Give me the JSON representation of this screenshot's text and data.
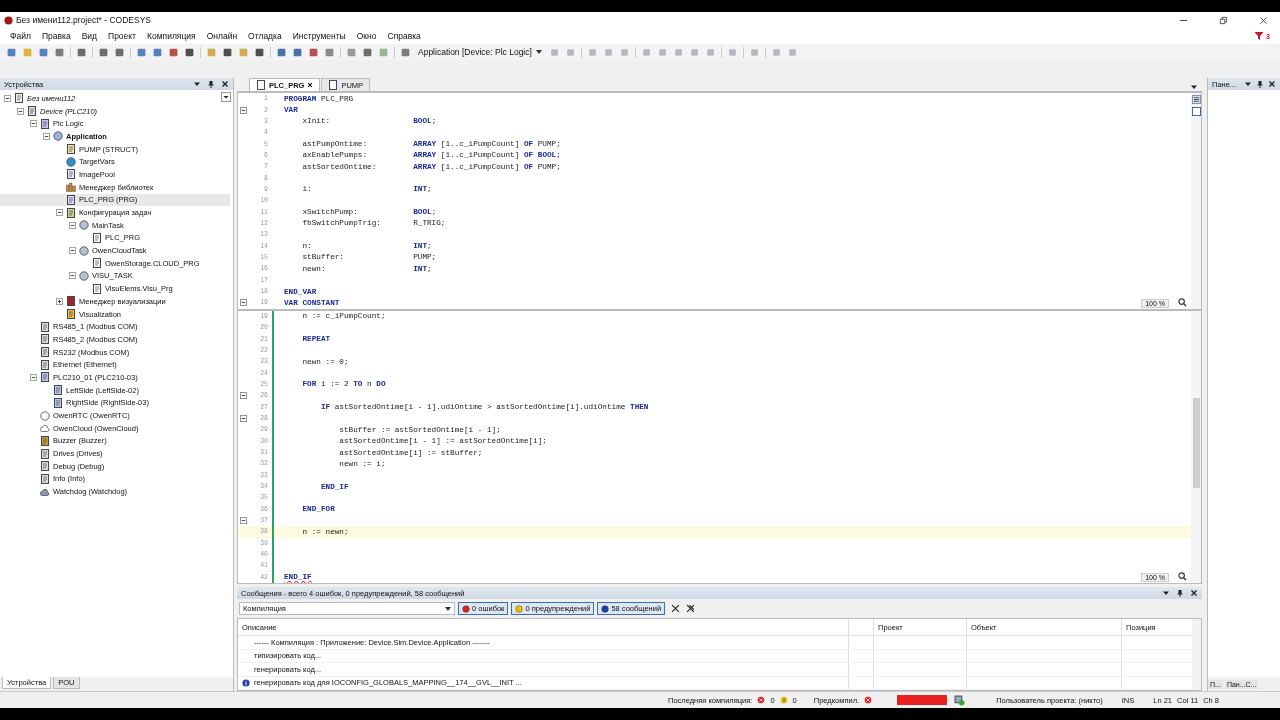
{
  "window": {
    "title": "Без имени112.project* - CODESYS"
  },
  "menu": [
    "Файл",
    "Правка",
    "Вид",
    "Проект",
    "Компиляция",
    "Онлайн",
    "Отладка",
    "Инструменты",
    "Окно",
    "Справка"
  ],
  "notification": {
    "count": "3"
  },
  "toolbar": {
    "application_selector": "Application [Device: Plc Logic]"
  },
  "devices_panel": {
    "title": "Устройства",
    "tree": [
      {
        "label": "Без имени112",
        "kind": "project",
        "expanded": true,
        "selected": false,
        "children": [
          {
            "label": "Device (PLC210)",
            "kind": "device",
            "expanded": true,
            "selected": false,
            "children": [
              {
                "label": "Plc Logic",
                "kind": "logic",
                "expanded": true,
                "selected": false,
                "children": [
                  {
                    "label": "Application",
                    "kind": "application",
                    "expanded": true,
                    "selected": false,
                    "children": [
                      {
                        "label": "PUMP (STRUCT)",
                        "kind": "struct",
                        "selected": false
                      },
                      {
                        "label": "TargetVars",
                        "kind": "globals",
                        "selected": false
                      },
                      {
                        "label": "ImagePool",
                        "kind": "images",
                        "selected": false
                      },
                      {
                        "label": "Менеджер библиотек",
                        "kind": "library",
                        "selected": false
                      },
                      {
                        "label": "PLC_PRG (PRG)",
                        "kind": "program",
                        "selected": true
                      },
                      {
                        "label": "Конфигурация задач",
                        "kind": "tasks",
                        "expanded": true,
                        "selected": false,
                        "children": [
                          {
                            "label": "MainTask",
                            "kind": "task",
                            "expanded": true,
                            "selected": false,
                            "children": [
                              {
                                "label": "PLC_PRG",
                                "kind": "call",
                                "selected": false
                              }
                            ]
                          },
                          {
                            "label": "OwenCloudTask",
                            "kind": "task",
                            "expanded": true,
                            "selected": false,
                            "children": [
                              {
                                "label": "OwenStorage.CLOUD_PRG",
                                "kind": "call",
                                "selected": false
                              }
                            ]
                          },
                          {
                            "label": "VISU_TASK",
                            "kind": "task",
                            "expanded": true,
                            "selected": false,
                            "children": [
                              {
                                "label": "VisuElems.Visu_Prg",
                                "kind": "call",
                                "selected": false
                              }
                            ]
                          }
                        ]
                      },
                      {
                        "label": "Менеджер визуализации",
                        "kind": "visu_manager",
                        "expanded": false,
                        "selected": false
                      },
                      {
                        "label": "Visualization",
                        "kind": "visualization",
                        "selected": false
                      }
                    ]
                  }
                ]
              },
              {
                "label": "RS485_1 (Modbus COM)",
                "kind": "port",
                "selected": false
              },
              {
                "label": "RS485_2 (Modbus COM)",
                "kind": "port",
                "selected": false
              },
              {
                "label": "RS232 (Modbus COM)",
                "kind": "port",
                "selected": false
              },
              {
                "label": "Ethernet (Ethernet)",
                "kind": "port",
                "selected": false
              },
              {
                "label": "PLC210_01 (PLC210-03)",
                "kind": "module",
                "expanded": true,
                "selected": false,
                "children": [
                  {
                    "label": "LeftSide (LeftSide-02)",
                    "kind": "module",
                    "selected": false
                  },
                  {
                    "label": "RightSide (RightSide-03)",
                    "kind": "module",
                    "selected": false
                  }
                ]
              },
              {
                "label": "OwenRTC (OwenRTC)",
                "kind": "clock",
                "selected": false
              },
              {
                "label": "OwenCloud (OwenCloud)",
                "kind": "cloud",
                "selected": false
              },
              {
                "label": "Buzzer (Buzzer)",
                "kind": "speaker",
                "selected": false
              },
              {
                "label": "Drives (Drives)",
                "kind": "port",
                "selected": false
              },
              {
                "label": "Debug (Debug)",
                "kind": "port",
                "selected": false
              },
              {
                "label": "Info (Info)",
                "kind": "port",
                "selected": false
              },
              {
                "label": "Watchdog (Watchdog)",
                "kind": "watchdog",
                "selected": false
              }
            ]
          }
        ]
      }
    ]
  },
  "bottom_tabs": [
    {
      "label": "Устройства",
      "selected": true
    },
    {
      "label": "POU",
      "selected": false
    }
  ],
  "editor": {
    "tabs": [
      {
        "label": "PLC_PRG",
        "selected": true,
        "closable": true
      },
      {
        "label": "PUMP",
        "selected": false,
        "closable": false
      }
    ],
    "declaration": {
      "zoom": "100 %",
      "lines": [
        {
          "n": "1",
          "text": "**PROGRAM** PLC_PRG",
          "fold": false
        },
        {
          "n": "2",
          "text": "**VAR**",
          "fold": true
        },
        {
          "n": "3",
          "text": "    xInit:                  **BOOL**;",
          "fold": false
        },
        {
          "n": "4",
          "fold": false
        },
        {
          "n": "5",
          "text": "    astPumpOntime:          **ARRAY** [1..c_iPumpCount] **OF** PUMP;",
          "fold": false
        },
        {
          "n": "6",
          "text": "    axEnablePumps:          **ARRAY** [1..c_iPumpCount] **OF** **BOOL**;",
          "fold": false
        },
        {
          "n": "7",
          "text": "    astSortedOntime:        **ARRAY** [1..c_iPumpCount] **OF** PUMP;",
          "fold": false
        },
        {
          "n": "8",
          "fold": false
        },
        {
          "n": "9",
          "text": "    i:                      **INT**;",
          "fold": false
        },
        {
          "n": "10",
          "fold": false
        },
        {
          "n": "11",
          "text": "    xSwitchPump:            **BOOL**;",
          "fold": false
        },
        {
          "n": "12",
          "text": "    fbSwitchPumpTrig:       R_TRIG;",
          "fold": false
        },
        {
          "n": "13",
          "fold": false
        },
        {
          "n": "14",
          "text": "    n:                      **INT**;",
          "fold": false
        },
        {
          "n": "15",
          "text": "    stBuffer:               PUMP;",
          "fold": false
        },
        {
          "n": "16",
          "text": "    newn:                   **INT**;",
          "fold": false
        },
        {
          "n": "17",
          "fold": false
        },
        {
          "n": "18",
          "text": "**END_VAR**",
          "fold": false
        },
        {
          "n": "19",
          "text": "**VAR CONSTANT**",
          "fold": true
        }
      ]
    },
    "implementation": {
      "zoom": "100 %",
      "lines": [
        {
          "n": "19",
          "text": "    n := c_iPumpCount;",
          "fold": false,
          "current": false,
          "error": false
        },
        {
          "n": "20",
          "fold": false,
          "current": false
        },
        {
          "n": "21",
          "text": "    **REPEAT**",
          "fold": false,
          "current": false,
          "error": false
        },
        {
          "n": "22",
          "fold": false,
          "current": false
        },
        {
          "n": "23",
          "text": "    newn := 0;",
          "fold": false,
          "current": false,
          "error": false
        },
        {
          "n": "24",
          "fold": false,
          "current": false
        },
        {
          "n": "25",
          "text": "    **FOR** i := 2 **TO** n **DO**",
          "fold": false,
          "current": false,
          "error": false
        },
        {
          "n": "26",
          "fold": true,
          "current": false
        },
        {
          "n": "27",
          "text": "        **IF** astSortedOntime[i - 1].udiOntime > astSortedOntime[i].udiOntime **THEN**",
          "fold": false,
          "current": false,
          "error": false
        },
        {
          "n": "28",
          "fold": true,
          "current": false
        },
        {
          "n": "29",
          "text": "            stBuffer := astSortedOntime[i - 1];",
          "fold": false,
          "current": false,
          "error": false
        },
        {
          "n": "30",
          "text": "            astSortedOntime[i - 1] := astSortedOntime[i];",
          "fold": false,
          "current": false,
          "error": false
        },
        {
          "n": "31",
          "text": "            astSortedOntime[i] := stBuffer;",
          "fold": false,
          "current": false,
          "error": false
        },
        {
          "n": "32",
          "text": "            newn := i;",
          "fold": false,
          "current": false,
          "error": false
        },
        {
          "n": "33",
          "fold": false,
          "current": false
        },
        {
          "n": "34",
          "text": "        **END_IF**",
          "fold": false,
          "current": false,
          "error": false
        },
        {
          "n": "35",
          "fold": false,
          "current": false
        },
        {
          "n": "36",
          "text": "    **END_FOR**",
          "fold": false,
          "current": false,
          "error": false
        },
        {
          "n": "37",
          "fold": true,
          "current": false
        },
        {
          "n": "38",
          "text": "    n := newn;",
          "fold": false,
          "current": true,
          "error": false
        },
        {
          "n": "39",
          "fold": false,
          "current": false
        },
        {
          "n": "40",
          "fold": false,
          "current": false
        },
        {
          "n": "41",
          "fold": false,
          "current": false
        },
        {
          "n": "42",
          "text": "**END_IF**",
          "fold": false,
          "current": false,
          "error": true
        }
      ]
    }
  },
  "right_panel": {
    "title": "Пане...",
    "tabs": [
      "П...",
      "Пан...С..."
    ]
  },
  "messages": {
    "title": "Сообщения - всего 4 ошибок, 0 предупреждений, 58 сообщений",
    "source": "Компиляция",
    "filters": [
      {
        "kind": "error",
        "label": "0 ошибок",
        "on": true
      },
      {
        "kind": "warning",
        "label": "0 предупреждений",
        "on": true
      },
      {
        "kind": "info",
        "label": "58 сообщений",
        "on": true
      }
    ],
    "columns": [
      "Описание",
      "Проект",
      "Объект",
      "Позиция"
    ],
    "rows": [
      {
        "kind": "plain",
        "text": "------ Компиляция : Приложение: Device.Sim.Device.Application -------"
      },
      {
        "kind": "plain",
        "text": "типизировать код..."
      },
      {
        "kind": "plain",
        "text": "генерировать код..."
      },
      {
        "kind": "info",
        "text": "генерировать код для IOCONFIG_GLOBALS_MAPPING__174__GVL__INIT ..."
      }
    ]
  },
  "status_bar": {
    "last_compile": "Последняя компиляция:",
    "errors": "0",
    "warnings": "0",
    "precompile": "Предкомпил.",
    "user": "Пользователь проекта: (никто)",
    "mode": "INS",
    "line": "Ln 21",
    "col": "Col 11",
    "ch": "Ch 8"
  }
}
